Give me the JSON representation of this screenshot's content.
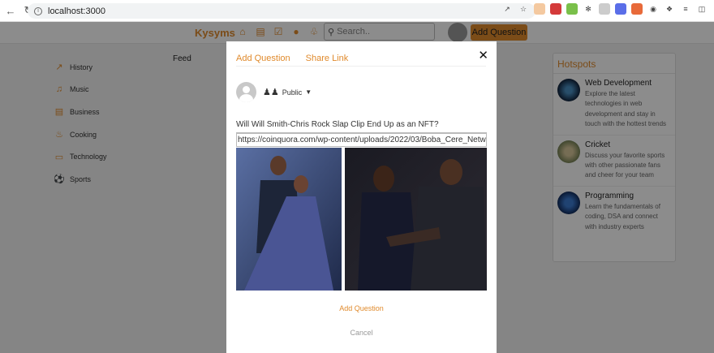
{
  "browser": {
    "url": "localhost:3000"
  },
  "app": {
    "logo": "Kysyms",
    "search_placeholder": "Search..",
    "add_question_label": "Add Question"
  },
  "sidebar": {
    "items": [
      {
        "label": "History",
        "icon": "trending-icon"
      },
      {
        "label": "Music",
        "icon": "music-icon"
      },
      {
        "label": "Business",
        "icon": "briefcase-icon"
      },
      {
        "label": "Cooking",
        "icon": "cooking-icon"
      },
      {
        "label": "Technology",
        "icon": "laptop-icon"
      },
      {
        "label": "Sports",
        "icon": "sports-ball-icon"
      }
    ]
  },
  "feed": {
    "title": "Feed"
  },
  "hotspots": {
    "title": "Hotspots",
    "items": [
      {
        "title": "Web Development",
        "desc": "Explore the latest technologies in web development and stay in touch with the hottest trends"
      },
      {
        "title": "Cricket",
        "desc": "Discuss your favorite sports with other passionate fans and cheer for your team"
      },
      {
        "title": "Programming",
        "desc": "Learn the fundamentals of coding, DSA and connect with industry experts"
      }
    ]
  },
  "modal": {
    "tab_add": "Add Question",
    "tab_share": "Share Link",
    "visibility": "Public",
    "question": "Will Will Smith-Chris Rock Slap Clip End Up as an NFT?",
    "url": "https://coinquora.com/wp-content/uploads/2022/03/Boba_Cere_Netw",
    "add_button": "Add Question",
    "cancel_button": "Cancel"
  },
  "colors": {
    "accent": "#e08a2c"
  }
}
